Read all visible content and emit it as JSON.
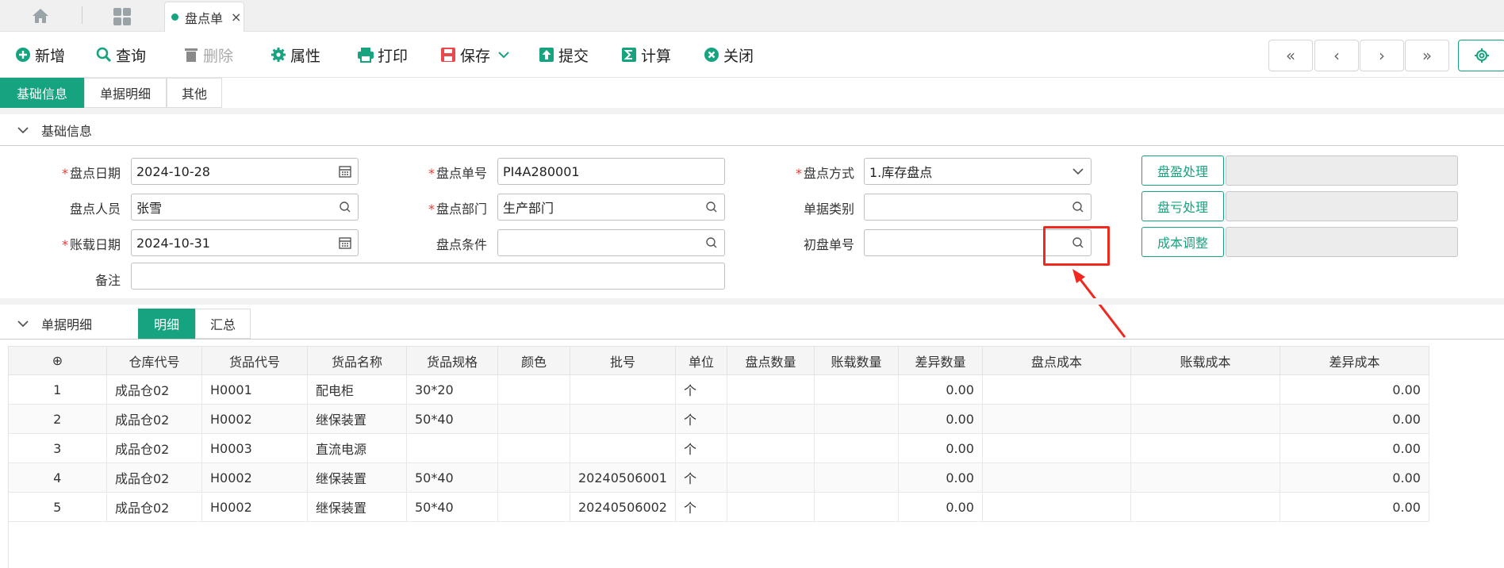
{
  "tabs": {
    "doc_tab_label": "盘点单",
    "close_glyph": "×"
  },
  "toolbar": {
    "add": "新增",
    "query": "查询",
    "delete": "删除",
    "properties": "属性",
    "print": "打印",
    "save": "保存",
    "submit": "提交",
    "calculate": "计算",
    "close": "关闭",
    "nav": {
      "first": "«",
      "prev": "‹",
      "next": "›",
      "last": "»"
    }
  },
  "section_tabs": [
    "基础信息",
    "单据明细",
    "其他"
  ],
  "basic": {
    "title": "基础信息",
    "fields": {
      "stock_date_label": "盘点日期",
      "stock_date_value": "2024-10-28",
      "stock_no_label": "盘点单号",
      "stock_no_value": "PI4A280001",
      "stock_method_label": "盘点方式",
      "stock_method_value": "1.库存盘点",
      "staff_label": "盘点人员",
      "staff_value": "张雪",
      "dept_label": "盘点部门",
      "dept_value": "生产部门",
      "doc_type_label": "单据类别",
      "doc_type_value": "",
      "book_date_label": "账载日期",
      "book_date_value": "2024-10-31",
      "condition_label": "盘点条件",
      "condition_value": "",
      "initial_no_label": "初盘单号",
      "initial_no_value": "",
      "remark_label": "备注",
      "remark_value": ""
    },
    "buttons": {
      "surplus": "盘盈处理",
      "loss": "盘亏处理",
      "cost_adjust": "成本调整"
    },
    "required_mark": "*"
  },
  "detail": {
    "title": "单据明细",
    "tabs": [
      "明细",
      "汇总"
    ],
    "columns": [
      "⊕",
      "仓库代号",
      "货品代号",
      "货品名称",
      "货品规格",
      "颜色",
      "批号",
      "单位",
      "盘点数量",
      "账载数量",
      "差异数量",
      "盘点成本",
      "账载成本",
      "差异成本"
    ],
    "rows": [
      [
        "1",
        "成品仓02",
        "H0001",
        "配电柜",
        "30*20",
        "",
        "",
        "个",
        "",
        "",
        "0.00",
        "",
        "",
        "0.00"
      ],
      [
        "2",
        "成品仓02",
        "H0002",
        "继保装置",
        "50*40",
        "",
        "",
        "个",
        "",
        "",
        "0.00",
        "",
        "",
        "0.00"
      ],
      [
        "3",
        "成品仓02",
        "H0003",
        "直流电源",
        "",
        "",
        "",
        "个",
        "",
        "",
        "0.00",
        "",
        "",
        "0.00"
      ],
      [
        "4",
        "成品仓02",
        "H0002",
        "继保装置",
        "50*40",
        "",
        "20240506001",
        "个",
        "",
        "",
        "0.00",
        "",
        "",
        "0.00"
      ],
      [
        "5",
        "成品仓02",
        "H0002",
        "继保装置",
        "50*40",
        "",
        "20240506002",
        "个",
        "",
        "",
        "0.00",
        "",
        "",
        "0.00"
      ]
    ]
  },
  "colors": {
    "accent": "#16a37f",
    "annotation": "#f0281e"
  },
  "icons": [
    "home-icon",
    "apps-grid-icon",
    "plus-circle-icon",
    "search-icon",
    "trash-icon",
    "gear-icon",
    "printer-icon",
    "save-icon",
    "upload-icon",
    "sigma-icon",
    "close-circle-icon",
    "calendar-icon",
    "chevron-down-icon",
    "arrow-icon"
  ]
}
